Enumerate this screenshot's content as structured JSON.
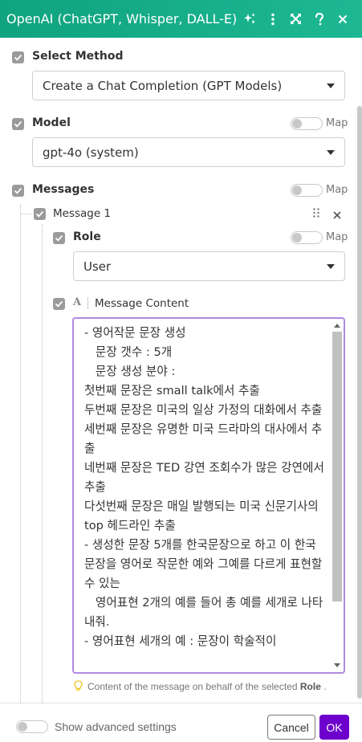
{
  "header": {
    "title": "OpenAI (ChatGPT, Whisper, DALL-E)",
    "background": "#10a37f",
    "icons": [
      "magic-sparkles-icon",
      "more-vert-icon",
      "expand-icon",
      "help-icon",
      "close-icon"
    ]
  },
  "method": {
    "label": "Select Method",
    "value": "Create a Chat Completion (GPT Models)"
  },
  "model": {
    "label": "Model",
    "map_label": "Map",
    "value": "gpt-4o (system)"
  },
  "messages": {
    "label": "Messages",
    "map_label": "Map",
    "item": {
      "label": "Message 1",
      "role": {
        "label": "Role",
        "map_label": "Map",
        "value": "User"
      },
      "content": {
        "type_icon": "A",
        "label": "Message Content",
        "text": "- 영어작문 문장 생성\n   문장 갯수 : 5개\n   문장 생성 분야 :\n첫번째 문장은 small talk에서 추출\n두번째 문장은 미국의 일상 가정의 대화에서 추출\n세번째 문장은 유명한 미국 드라마의 대사에서 추출\n네번째 문장은 TED 강연 조회수가 많은 강연에서 추출\n다섯번째 문장은 매일 발행되는 미국 신문기사의 top 헤드라인 추출\n- 생성한 문장 5개를 한국문장으로 하고 이 한국문장을 영어로 작문한 예와 그예를 다르게 표현할수 있는\n   영어표현 2개의 예를 들어 총 예를 세개로 나타내줘.\n- 영어표현 세개의 예 : 문장이 학술적이"
      },
      "hint": {
        "prefix": "Content of the message on behalf of the selected",
        "bold": "Role",
        "suffix": "."
      }
    }
  },
  "footer": {
    "advanced_label": "Show advanced settings",
    "cancel_label": "Cancel",
    "ok_label": "OK",
    "ok_color": "#6d00cc"
  }
}
